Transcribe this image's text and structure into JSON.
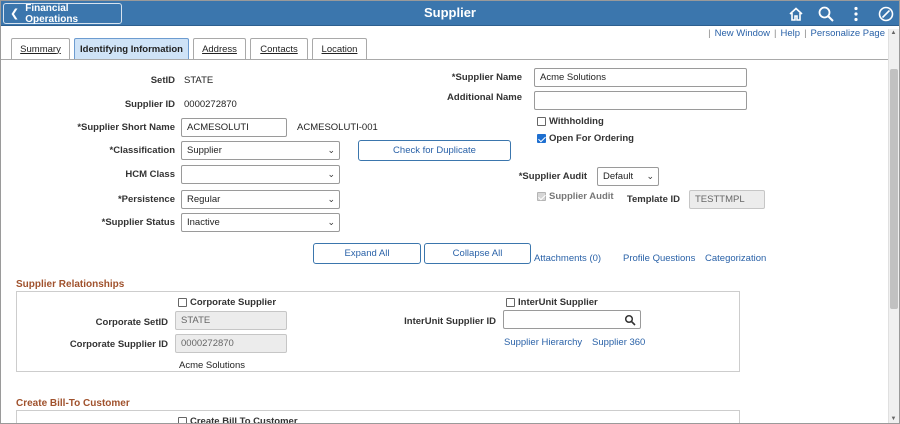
{
  "banner": {
    "back_label": "Financial Operations",
    "title": "Supplier",
    "icons": [
      "home-icon",
      "search-icon",
      "more-vertical-icon",
      "navbar-icon"
    ]
  },
  "topnav": {
    "new_window": "New Window",
    "help": "Help",
    "personalize": "Personalize Page"
  },
  "tabs": [
    {
      "label": "Summary",
      "active": false
    },
    {
      "label": "Identifying Information",
      "active": true
    },
    {
      "label": "Address",
      "active": false
    },
    {
      "label": "Contacts",
      "active": false
    },
    {
      "label": "Location",
      "active": false
    }
  ],
  "form": {
    "setid_label": "SetID",
    "setid_value": "STATE",
    "supplier_id_label": "Supplier ID",
    "supplier_id_value": "0000272870",
    "short_name_label": "*Supplier Short Name",
    "short_name_value": "ACMESOLUTI",
    "short_name_suffix": "ACMESOLUTI-001",
    "classification_label": "*Classification",
    "classification_value": "Supplier",
    "hcm_class_label": "HCM Class",
    "hcm_class_value": "",
    "persistence_label": "*Persistence",
    "persistence_value": "Regular",
    "status_label": "*Supplier Status",
    "status_value": "Inactive",
    "check_duplicate": "Check for Duplicate",
    "supplier_name_label": "*Supplier Name",
    "supplier_name_value": "Acme Solutions",
    "additional_name_label": "Additional Name",
    "additional_name_value": "",
    "withholding_label": "Withholding",
    "withholding_checked": false,
    "open_ordering_label": "Open For Ordering",
    "open_ordering_checked": true,
    "audit_label": "*Supplier Audit",
    "audit_value": "Default",
    "audit_cb_label": "Supplier Audit",
    "template_id_label": "Template ID",
    "template_id_value": "TESTTMPL"
  },
  "actions": {
    "expand_all": "Expand All",
    "collapse_all": "Collapse All",
    "attachments": "Attachments (0)",
    "profile_questions": "Profile Questions",
    "categorization": "Categorization"
  },
  "relationships": {
    "title": "Supplier Relationships",
    "corporate_supplier_label": "Corporate Supplier",
    "corporate_setid_label": "Corporate SetID",
    "corporate_setid_value": "STATE",
    "corporate_supplier_id_label": "Corporate Supplier ID",
    "corporate_supplier_id_value": "0000272870",
    "corporate_name": "Acme Solutions",
    "interunit_supplier_label": "InterUnit Supplier",
    "interunit_id_label": "InterUnit Supplier ID",
    "interunit_id_value": "",
    "supplier_hierarchy": "Supplier Hierarchy",
    "supplier_360": "Supplier 360"
  },
  "bill_to": {
    "title": "Create Bill-To Customer",
    "create_label": "Create Bill To Customer"
  },
  "colors": {
    "banner": "#3b76ad",
    "link": "#2a62a8",
    "section_title": "#a0522d",
    "active_tab": "#cfe3f7"
  }
}
